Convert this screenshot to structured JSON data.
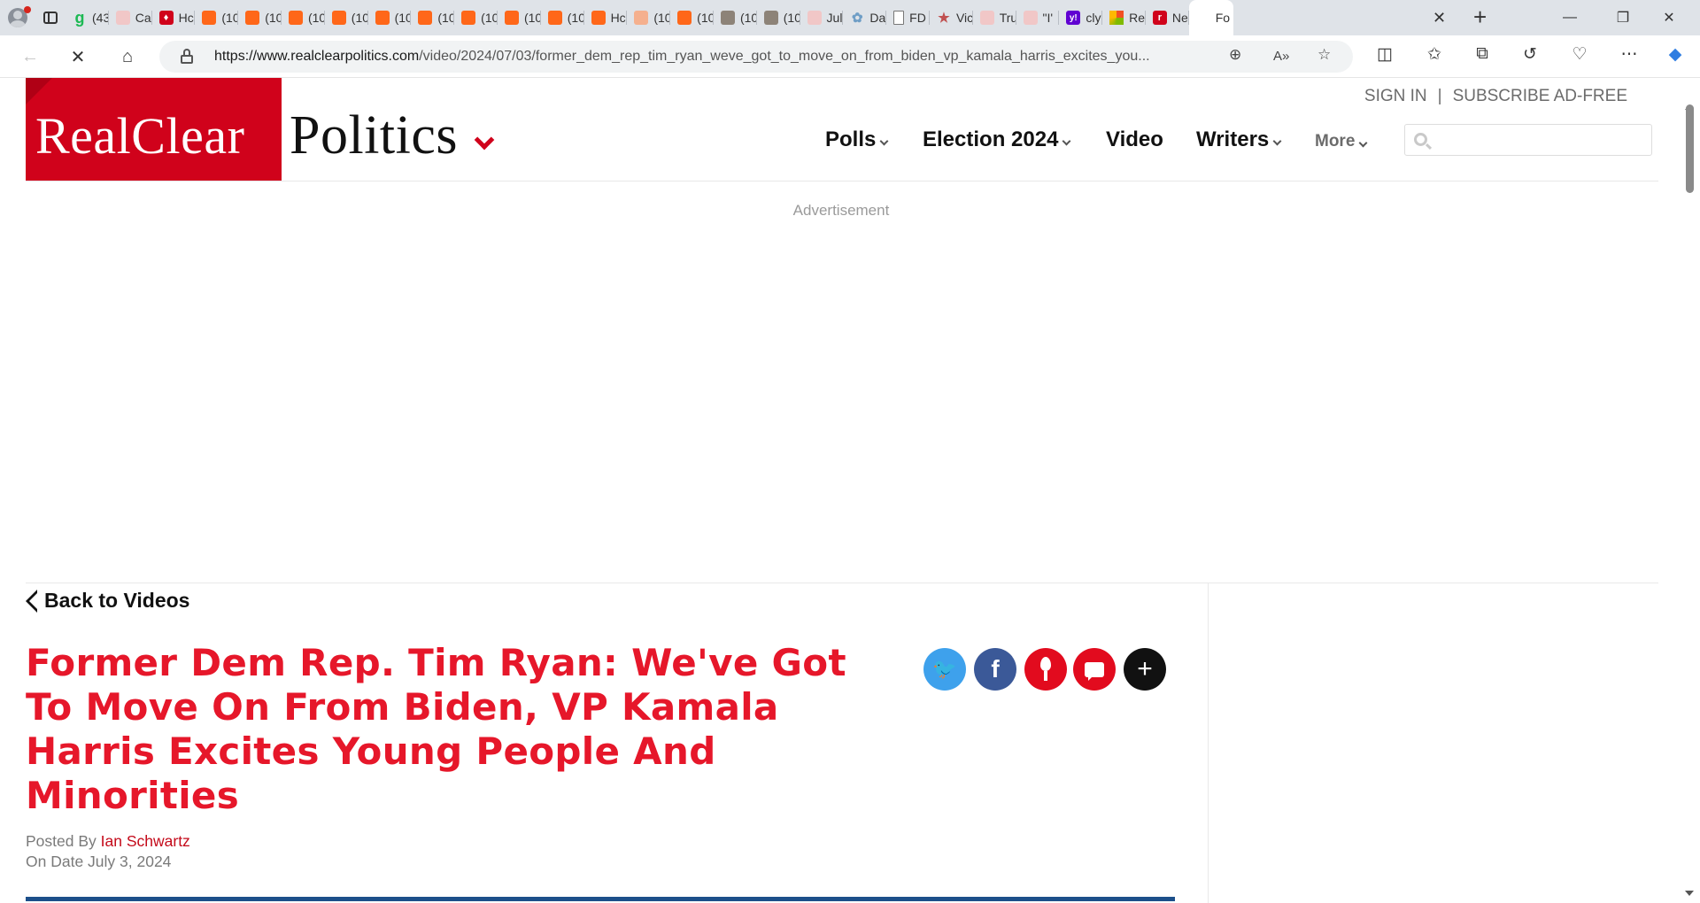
{
  "browser": {
    "tabs": [
      {
        "favicon": "g-icon",
        "label": "(43"
      },
      {
        "favicon": "youtube-icon",
        "label": "Ca"
      },
      {
        "favicon": "rcp-torch-icon",
        "label": "Hc"
      },
      {
        "favicon": "substack-icon",
        "label": "(10"
      },
      {
        "favicon": "substack-icon",
        "label": "(10"
      },
      {
        "favicon": "substack-icon",
        "label": "(10"
      },
      {
        "favicon": "substack-icon",
        "label": "(10"
      },
      {
        "favicon": "substack-icon",
        "label": "(10"
      },
      {
        "favicon": "substack-icon",
        "label": "(10"
      },
      {
        "favicon": "substack-icon",
        "label": "(10"
      },
      {
        "favicon": "substack-icon",
        "label": "(10"
      },
      {
        "favicon": "substack-icon",
        "label": "(10"
      },
      {
        "favicon": "substack-icon",
        "label": "Hc"
      },
      {
        "favicon": "substack-light-icon",
        "label": "(10"
      },
      {
        "favicon": "substack-icon",
        "label": "(10"
      },
      {
        "favicon": "photo-icon",
        "label": "(10"
      },
      {
        "favicon": "photo-icon",
        "label": "(10"
      },
      {
        "favicon": "youtube-icon",
        "label": "Jul"
      },
      {
        "favicon": "swirl-icon",
        "label": "Da"
      },
      {
        "favicon": "document-icon",
        "label": "FD"
      },
      {
        "favicon": "star-icon",
        "label": "Vic"
      },
      {
        "favicon": "youtube-icon",
        "label": "Tru"
      },
      {
        "favicon": "youtube-icon",
        "label": "\"I'"
      },
      {
        "favicon": "yahoo-icon",
        "label": "cly"
      },
      {
        "favicon": "microsoft-icon",
        "label": "Re"
      },
      {
        "favicon": "r-icon",
        "label": "Ne"
      }
    ],
    "active_tab": {
      "label": "Fo"
    },
    "url_domain": "https://www.realclearpolitics.com",
    "url_path": "/video/2024/07/03/former_dem_rep_tim_ryan_weve_got_to_move_on_from_biden_vp_kamala_harris_excites_you..."
  },
  "header": {
    "logo_red": "RealClear",
    "logo_word": "Politics",
    "sign_in": "SIGN IN",
    "separator": "|",
    "subscribe": "SUBSCRIBE AD-FREE",
    "nav": {
      "polls": "Polls",
      "election": "Election 2024",
      "video": "Video",
      "writers": "Writers",
      "more": "More"
    },
    "search_placeholder": ""
  },
  "ad_label": "Advertisement",
  "article": {
    "back_label": "Back to Videos",
    "headline": "Former Dem Rep. Tim Ryan: We've Got To Move On From Biden, VP Kamala Harris Excites Young People And Minorities",
    "posted_by_label": "Posted By",
    "author": "Ian Schwartz",
    "date_line": "On Date July 3, 2024"
  },
  "colors": {
    "brand_red": "#d0021b",
    "headline_red": "#e6172a",
    "twitter": "#3ea1ec",
    "facebook": "#3b5998"
  }
}
